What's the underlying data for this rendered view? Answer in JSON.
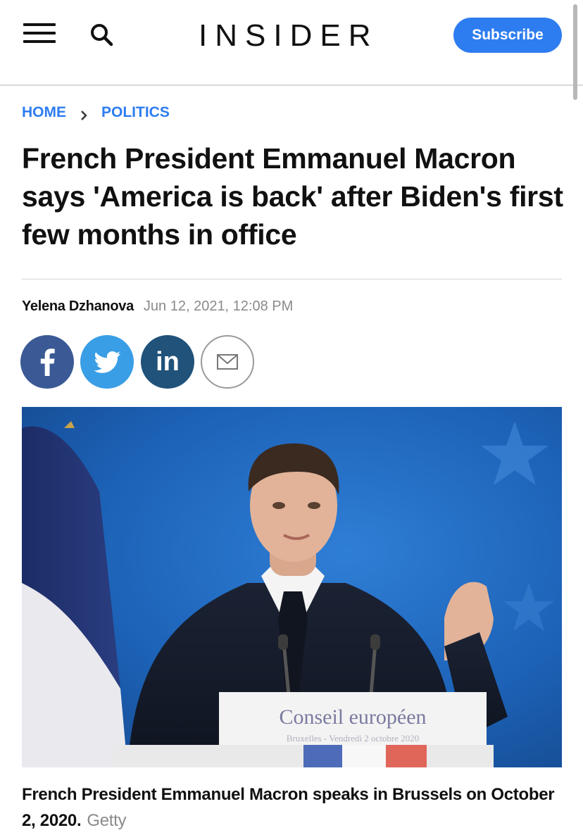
{
  "header": {
    "logo": "INSIDER",
    "subscribe_label": "Subscribe",
    "menu_icon": "hamburger-icon",
    "search_icon": "search-icon"
  },
  "breadcrumb": {
    "home": "HOME",
    "section": "POLITICS"
  },
  "article": {
    "headline": "French President Emmanuel Macron says 'America is back' after Biden's first few months in office",
    "author": "Yelena Dzhanova",
    "date": "Jun 12, 2021, 12:08 PM"
  },
  "share": {
    "facebook_icon": "facebook-icon",
    "twitter_icon": "twitter-icon",
    "linkedin_label": "in",
    "email_icon": "mail-icon"
  },
  "image": {
    "lectern_title": "Conseil européen",
    "lectern_subtitle": "Bruxelles - Vendredi 2 octobre 2020",
    "caption": "French President Emmanuel Macron speaks in Brussels on October 2, 2020.",
    "credit": "Getty"
  },
  "colors": {
    "accent": "#2e7df0",
    "facebook": "#3b5a95",
    "twitter": "#3a9ee6",
    "linkedin": "#20527a"
  }
}
